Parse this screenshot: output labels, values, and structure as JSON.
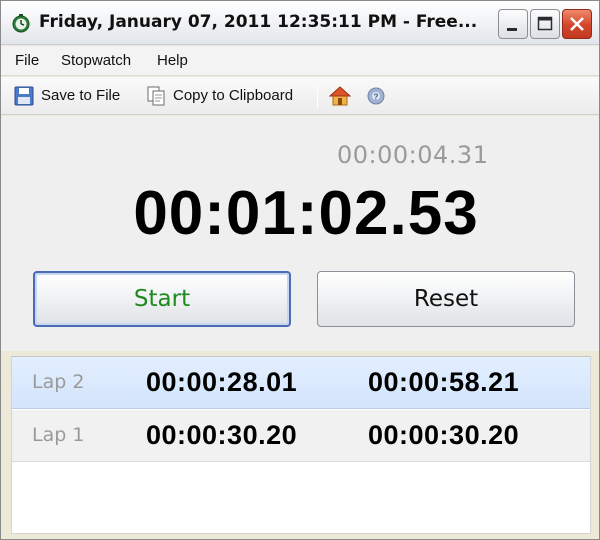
{
  "window": {
    "title": "Friday, January 07, 2011 12:35:11 PM - Free..."
  },
  "menu": {
    "items": [
      "File",
      "Stopwatch",
      "Help"
    ]
  },
  "toolbar": {
    "save_label": "Save to File",
    "copy_label": "Copy to Clipboard",
    "icons": [
      "save-icon",
      "copy-icon",
      "home-icon",
      "help-icon"
    ]
  },
  "timer": {
    "split_time": "00:00:04.31",
    "main_time": "00:01:02.53",
    "start_label": "Start",
    "reset_label": "Reset"
  },
  "laps": [
    {
      "label": "Lap 2",
      "lap_time": "00:00:28.01",
      "total_time": "00:00:58.21",
      "selected": true
    },
    {
      "label": "Lap 1",
      "lap_time": "00:00:30.20",
      "total_time": "00:00:30.20",
      "selected": false
    }
  ],
  "colors": {
    "start_text": "#1f8a1f",
    "selected_row": "#dce9fc",
    "split_text": "#9a9a9a"
  }
}
